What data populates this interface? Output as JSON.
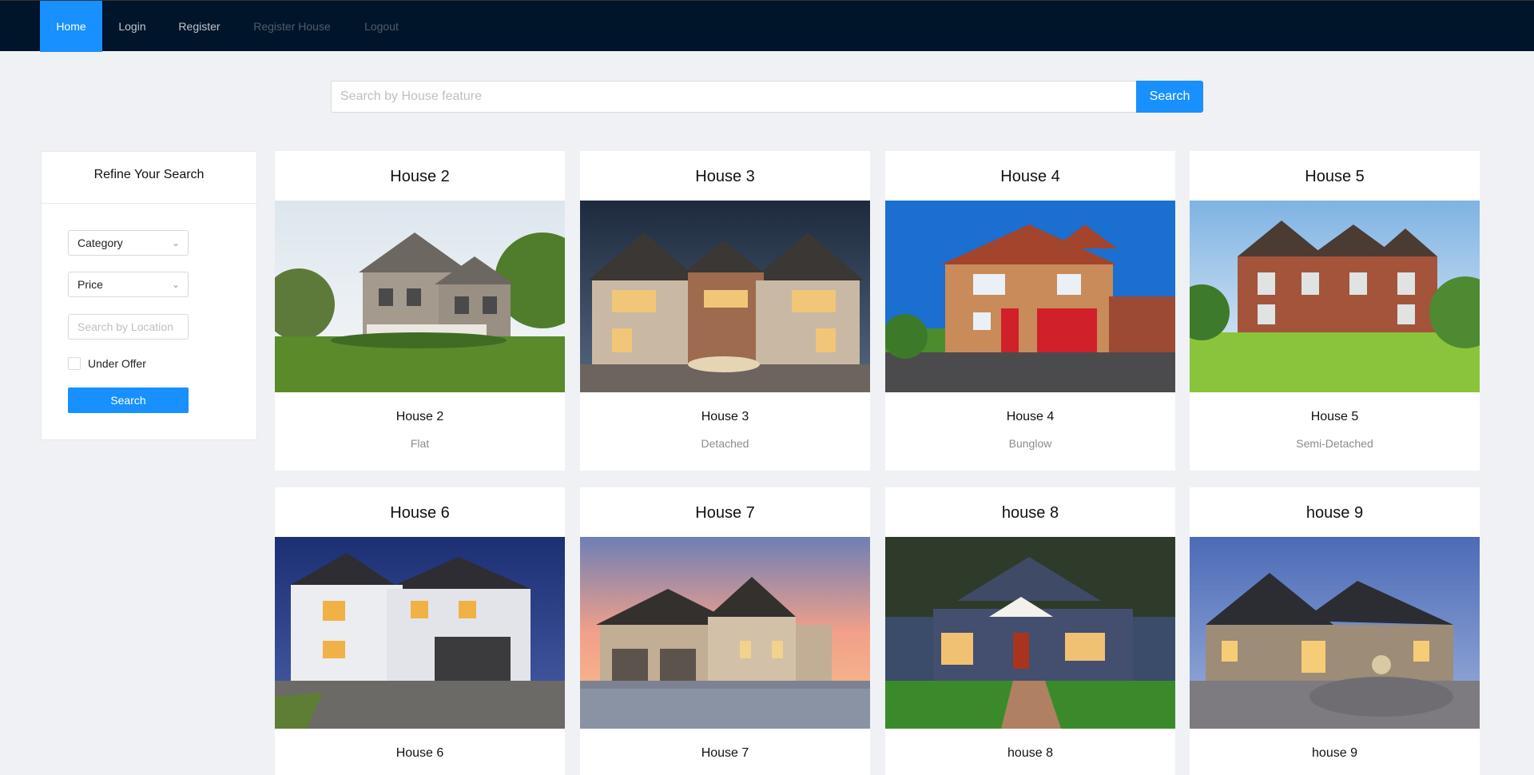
{
  "nav": {
    "items": [
      {
        "label": "Home",
        "state": "active"
      },
      {
        "label": "Login",
        "state": "normal"
      },
      {
        "label": "Register",
        "state": "normal"
      },
      {
        "label": "Register House",
        "state": "disabled"
      },
      {
        "label": "Logout",
        "state": "disabled"
      }
    ]
  },
  "search": {
    "placeholder": "Search by House feature",
    "button_label": "Search"
  },
  "filter": {
    "title": "Refine Your Search",
    "category_label": "Category",
    "price_label": "Price",
    "location_placeholder": "Search by Location",
    "under_offer_label": "Under Offer",
    "under_offer_checked": false,
    "button_label": "Search"
  },
  "houses": [
    {
      "title": "House 2",
      "name": "House 2",
      "type": "Flat",
      "scene": "dusk-green"
    },
    {
      "title": "House 3",
      "name": "House 3",
      "type": "Detached",
      "scene": "night-lit"
    },
    {
      "title": "House 4",
      "name": "House 4",
      "type": "Bunglow",
      "scene": "blue-sky-brick"
    },
    {
      "title": "House 5",
      "name": "House 5",
      "type": "Semi-Detached",
      "scene": "manor-lawn"
    },
    {
      "title": "House 6",
      "name": "House 6",
      "type": "",
      "scene": "twilight-white"
    },
    {
      "title": "House 7",
      "name": "House 7",
      "type": "",
      "scene": "sunset-pink"
    },
    {
      "title": "house 8",
      "name": "house 8",
      "type": "",
      "scene": "craftsman-dusk"
    },
    {
      "title": "house 9",
      "name": "house 9",
      "type": "",
      "scene": "stone-estate"
    }
  ]
}
